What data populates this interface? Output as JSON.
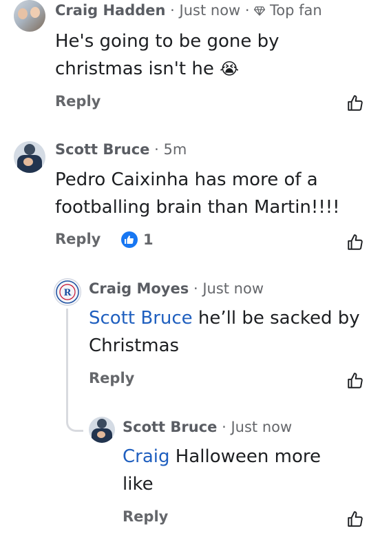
{
  "comments": [
    {
      "author": "Craig Hadden",
      "time": "Just now",
      "badge": "Top fan",
      "text": "He's going to be gone by christmas isn't he",
      "emoji": "😭",
      "reply_label": "Reply"
    },
    {
      "author": "Scott Bruce",
      "time": "5m",
      "text": "Pedro Caixinha has more of a footballing brain than Martin!!!!",
      "reply_label": "Reply",
      "reaction_count": "1"
    },
    {
      "author": "Craig Moyes",
      "time": "Just now",
      "mention": "Scott Bruce",
      "text": "he’ll be sacked by Christmas",
      "reply_label": "Reply"
    },
    {
      "author": "Scott Bruce",
      "time": "Just now",
      "mention": "Craig",
      "text": "Halloween more like",
      "reply_label": "Reply"
    }
  ],
  "separator": "·",
  "colors": {
    "mention": "#1f5fbf",
    "meta": "#65676b",
    "like_badge": "#1877f2"
  },
  "icons": [
    "thumbs-up-icon",
    "diamond-icon",
    "like-badge-icon"
  ]
}
